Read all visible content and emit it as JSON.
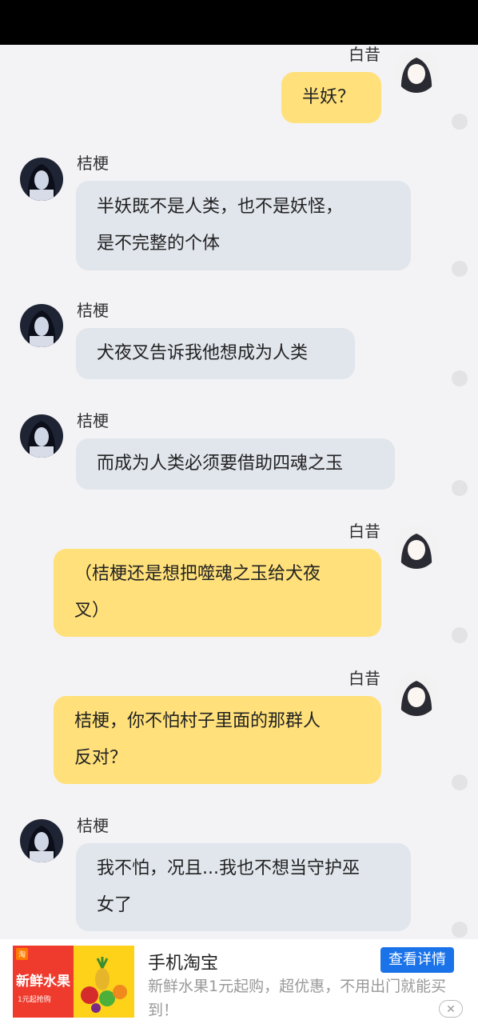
{
  "messages": [
    {
      "sender": "白昔",
      "side": "right",
      "text": [
        "半妖？"
      ]
    },
    {
      "sender": "桔梗",
      "side": "left",
      "text": [
        "半妖既不是人类，也不是妖怪，",
        "是不完整的个体"
      ]
    },
    {
      "sender": "桔梗",
      "side": "left",
      "text": [
        "犬夜叉告诉我他想成为人类"
      ]
    },
    {
      "sender": "桔梗",
      "side": "left",
      "text": [
        "而成为人类必须要借助四魂之玉"
      ]
    },
    {
      "sender": "白昔",
      "side": "right",
      "text": [
        "（桔梗还是想把噬魂之玉给犬夜",
        "叉）"
      ]
    },
    {
      "sender": "白昔",
      "side": "right",
      "text": [
        "桔梗，你不怕村子里面的那群人",
        "反对？"
      ]
    },
    {
      "sender": "桔梗",
      "side": "left",
      "text": [
        "我不怕，况且...我也不想当守护巫",
        "女了"
      ]
    }
  ],
  "ad": {
    "title": "手机淘宝",
    "button_label": "查看详情",
    "description": "新鲜水果1元起购，超优惠，不用出门就能买到！",
    "image_tag": "淘",
    "image_text": "新鲜水果",
    "image_subtext": "1元起抢购",
    "close_label": "✕"
  },
  "colors": {
    "left_bubble": "#e1e5ec",
    "right_bubble": "#ffe07a",
    "ad_button": "#1a73e8"
  }
}
